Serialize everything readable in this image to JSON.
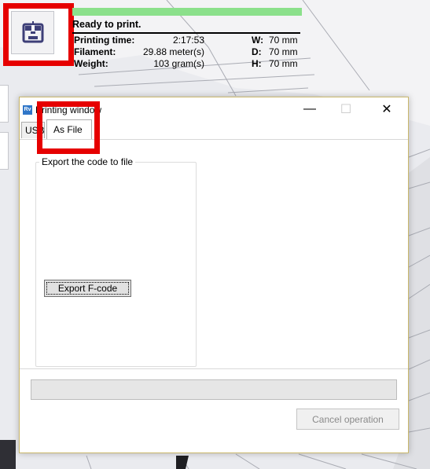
{
  "status": {
    "progress_fraction": 1.0,
    "title": "Ready to print.",
    "rows": [
      {
        "label": "Printing time:",
        "value": "2:17:53",
        "dim_label": "W:",
        "dim_value": "70 mm"
      },
      {
        "label": "Filament:",
        "value": "29.88 meter(s)",
        "dim_label": "D:",
        "dim_value": "70 mm"
      },
      {
        "label": "Weight:",
        "value": "103 gram(s)",
        "dim_label": "H:",
        "dim_value": "70 mm"
      }
    ]
  },
  "toolbar": {
    "print_icon": "printer-icon"
  },
  "window": {
    "app_icon_text": "Rv",
    "title": "Printing window",
    "minimize_glyph": "—",
    "maximize_glyph": "☐",
    "close_glyph": "✕",
    "tabs": [
      {
        "label": "USB"
      },
      {
        "label": "As File",
        "selected": true
      }
    ],
    "export_group_title": "Export the code to file",
    "export_button_label": "Export F-code",
    "progress_fraction": 0,
    "cancel_button_label": "Cancel operation"
  },
  "colors": {
    "progress_fill": "#8be08b",
    "annotation_red": "#e60000",
    "print_icon": "#3d3f78"
  }
}
